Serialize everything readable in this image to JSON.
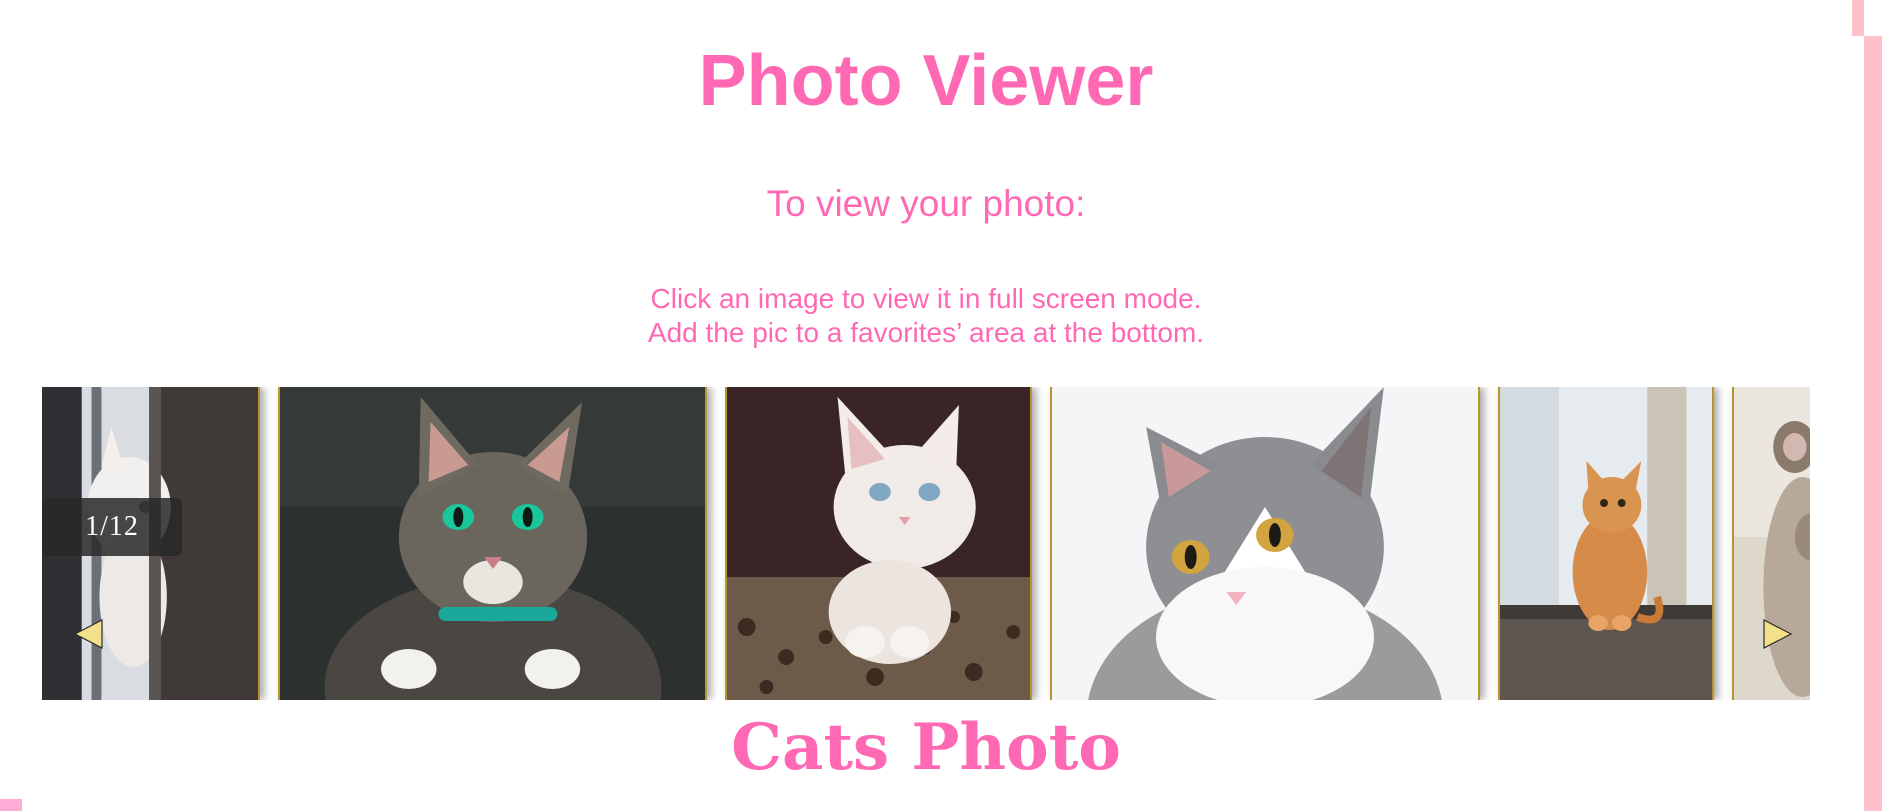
{
  "header": {
    "title": "Photo Viewer",
    "subtitle": "To view your photo:",
    "instruction_1": "Click an image to view it in full screen mode.",
    "instruction_2": "Add the pic to a favorites’ area at the bottom."
  },
  "gallery": {
    "counter": "1/12",
    "prev_icon": "left-triangle-icon",
    "next_icon": "right-triangle-icon",
    "photos": [
      {
        "name": "white-cat-peeking"
      },
      {
        "name": "tabby-cat-green-eyes"
      },
      {
        "name": "white-kitten-blue-eyes"
      },
      {
        "name": "grey-white-cat"
      },
      {
        "name": "orange-cat-window"
      },
      {
        "name": "cat-paw"
      }
    ]
  },
  "section": {
    "title": "Cats Photo"
  },
  "colors": {
    "accent": "#ff69b4",
    "edge": "#ffc0cb",
    "arrow": "#f2e08a",
    "frame": "#b8962e"
  }
}
